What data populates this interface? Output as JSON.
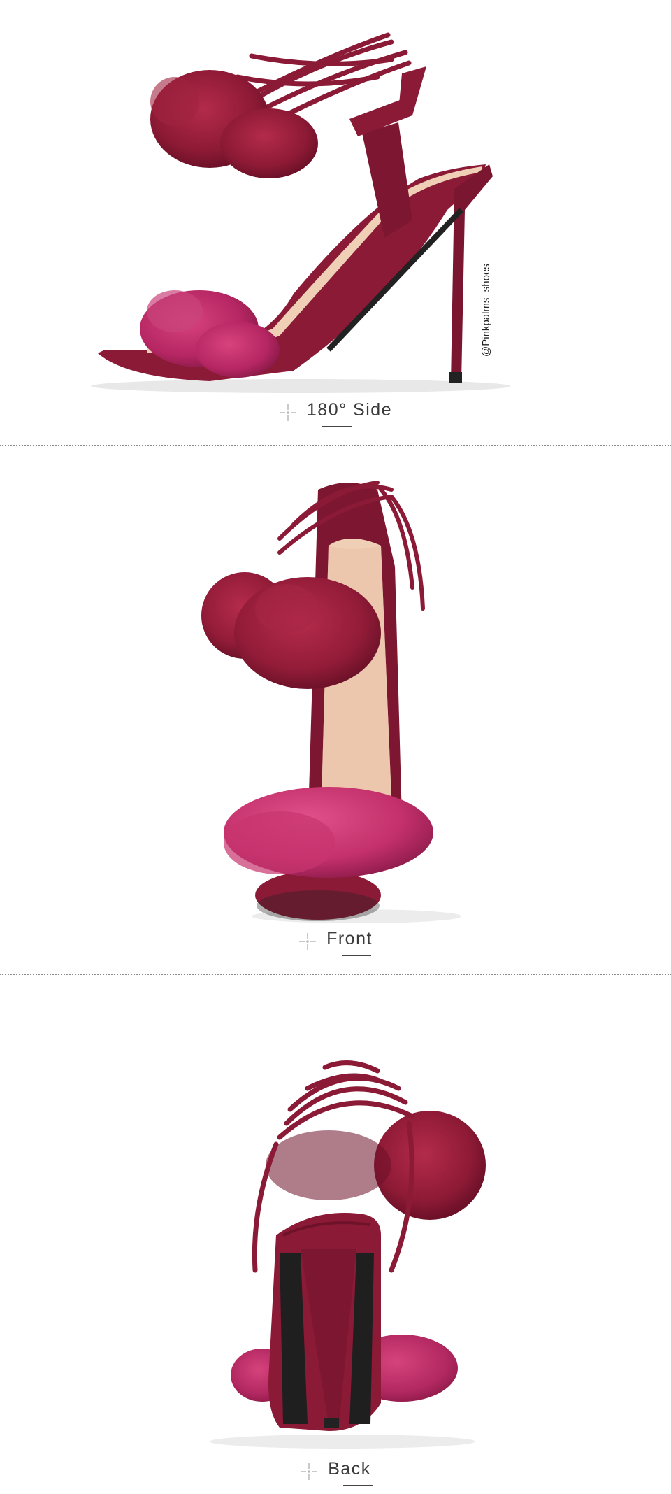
{
  "views": [
    {
      "label": "180°  Side"
    },
    {
      "label": "Front"
    },
    {
      "label": "Back"
    }
  ],
  "watermark": "@Pinkpalms_shoes",
  "colors": {
    "suede": "#8b1a36",
    "suede_dark": "#6a1128",
    "pompom": "#9c1f3d",
    "fur_front": "#c4306a",
    "insole": "#efd0b6",
    "sole": "#222222"
  }
}
